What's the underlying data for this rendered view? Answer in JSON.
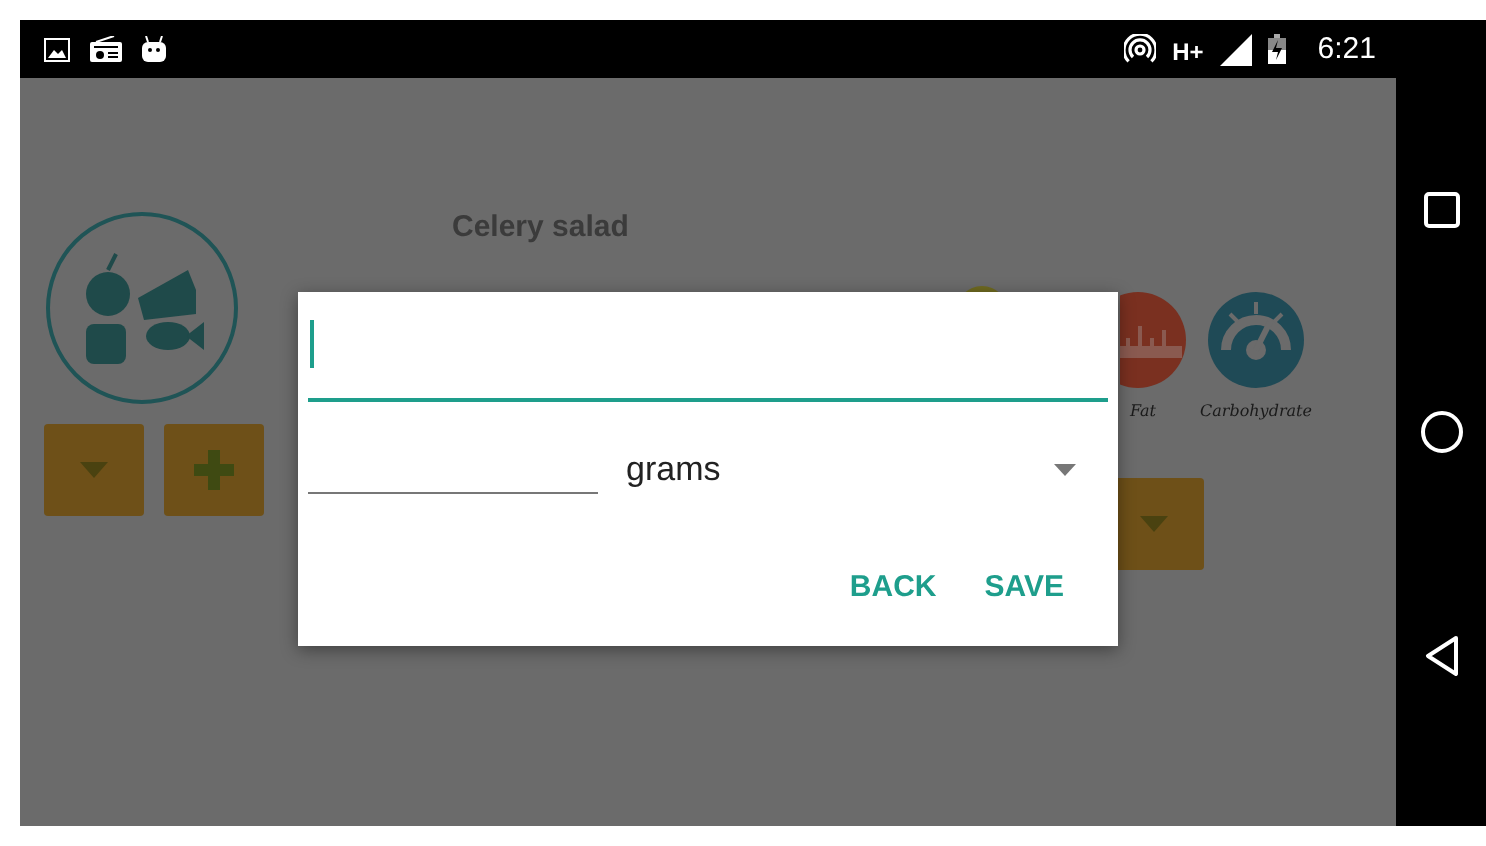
{
  "status_bar": {
    "network": "H+",
    "time": "6:21"
  },
  "screen": {
    "title": "Celery salad",
    "nutrients": [
      {
        "label": "Fat",
        "kind": "fat"
      },
      {
        "label": "Carbohydrate",
        "kind": "gauge"
      }
    ]
  },
  "dialog": {
    "fields": [
      {
        "kind": "name",
        "focused": true
      },
      {
        "kind": "quantity",
        "focused": false
      }
    ],
    "unit": "grams",
    "buttons": [
      "BACK",
      "SAVE"
    ]
  }
}
